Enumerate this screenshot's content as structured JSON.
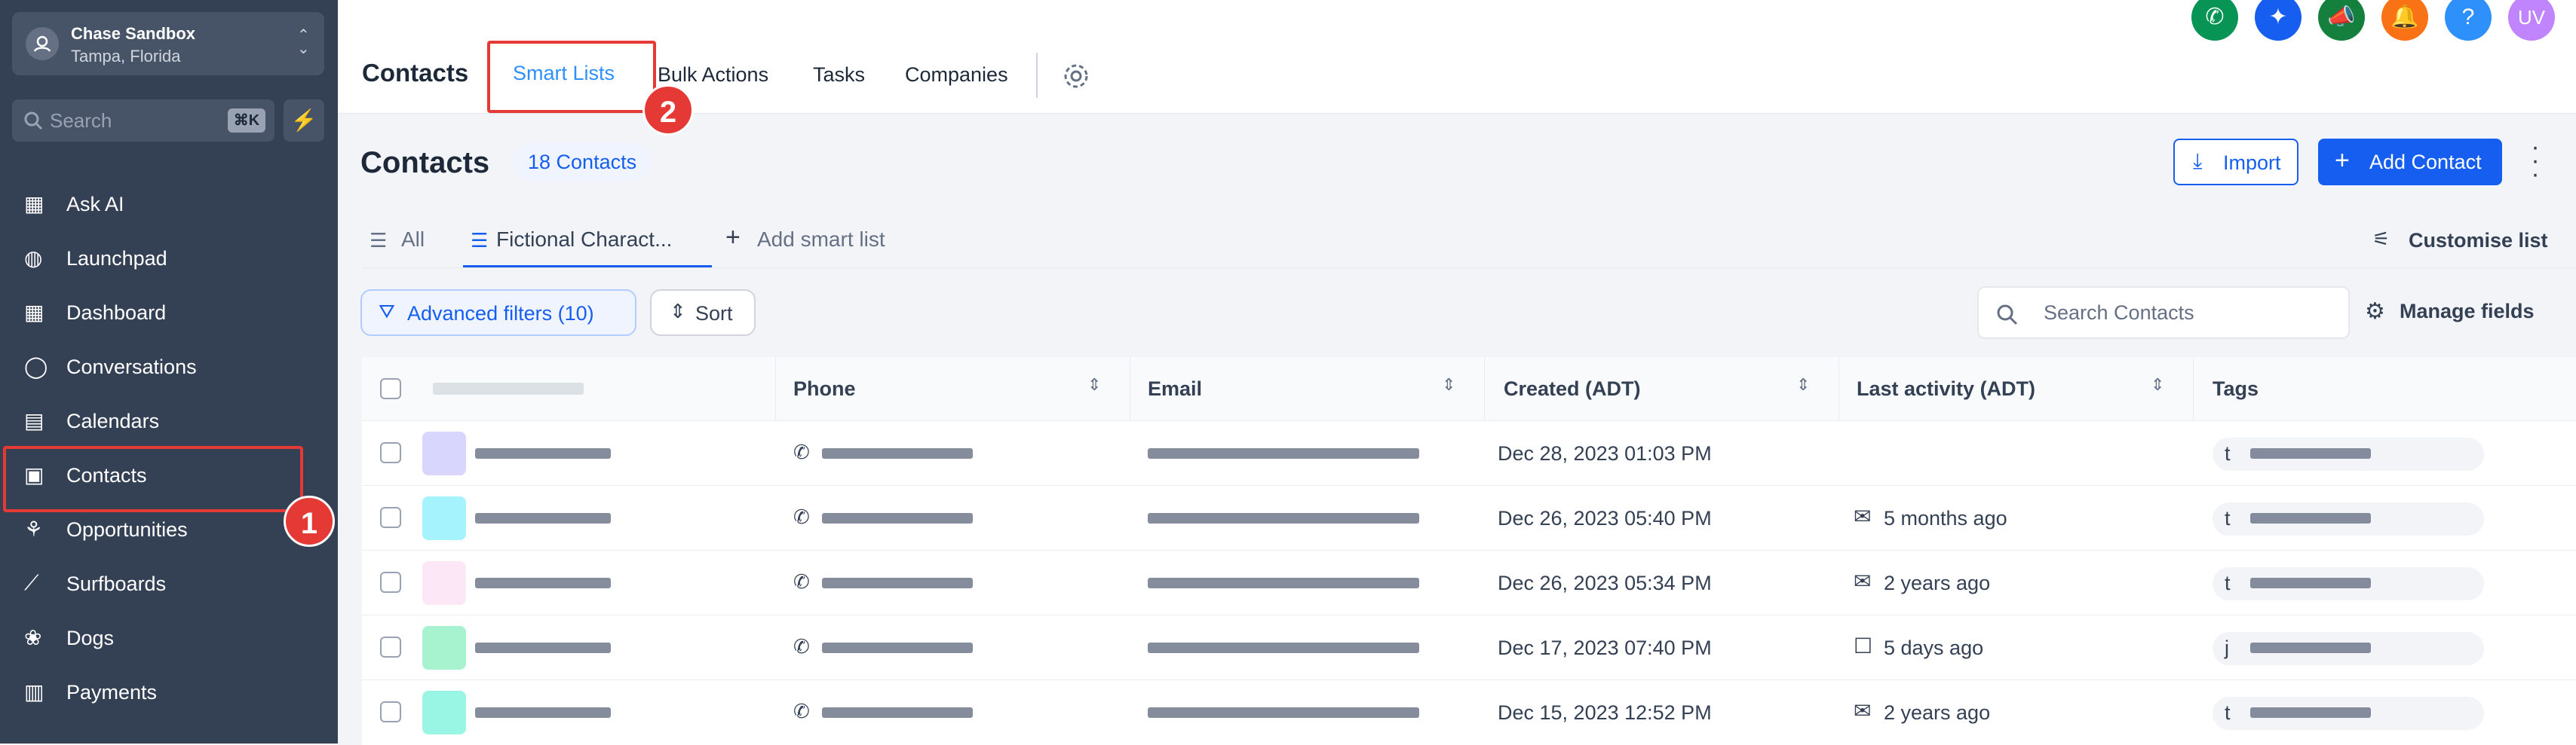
{
  "account": {
    "name": "Chase Sandbox",
    "location": "Tampa, Florida"
  },
  "sidebar": {
    "search_placeholder": "Search",
    "search_shortcut": "⌘K",
    "items": [
      {
        "label": "Ask AI",
        "icon": "grid-icon"
      },
      {
        "label": "Launchpad",
        "icon": "rocket-icon"
      },
      {
        "label": "Dashboard",
        "icon": "dashboard-icon"
      },
      {
        "label": "Conversations",
        "icon": "chat-icon"
      },
      {
        "label": "Calendars",
        "icon": "calendar-icon"
      },
      {
        "label": "Contacts",
        "icon": "contacts-icon"
      },
      {
        "label": "Opportunities",
        "icon": "opportunities-icon"
      },
      {
        "label": "Surfboards",
        "icon": "surfboard-icon"
      },
      {
        "label": "Dogs",
        "icon": "dog-icon"
      },
      {
        "label": "Payments",
        "icon": "payments-icon"
      }
    ]
  },
  "annotations": {
    "badge1": "1",
    "badge2": "2"
  },
  "topbar": {
    "title": "Contacts",
    "tabs": [
      "Smart Lists",
      "Bulk Actions",
      "Tasks",
      "Companies"
    ],
    "avatar": "UV",
    "help": "?"
  },
  "main": {
    "title": "Contacts",
    "count_badge": "18 Contacts",
    "import_label": "Import",
    "add_contact_label": "Add Contact",
    "list_tabs": [
      "All",
      "Fictional Charact...",
      "Add smart list"
    ],
    "customise_label": "Customise list",
    "advanced_filters_label": "Advanced filters (10)",
    "sort_label": "Sort",
    "search_placeholder": "Search Contacts",
    "manage_fields_label": "Manage fields"
  },
  "table": {
    "headers": [
      "Phone",
      "Email",
      "Created (ADT)",
      "Last activity (ADT)",
      "Tags"
    ],
    "rows": [
      {
        "created": "Dec 28, 2023 01:03 PM",
        "activity": "",
        "activity_icon": "",
        "tag_initial": "t"
      },
      {
        "created": "Dec 26, 2023 05:40 PM",
        "activity": "5 months ago",
        "activity_icon": "mail-icon",
        "tag_initial": "t"
      },
      {
        "created": "Dec 26, 2023 05:34 PM",
        "activity": "2 years ago",
        "activity_icon": "mail-icon",
        "tag_initial": "t"
      },
      {
        "created": "Dec 17, 2023 07:40 PM",
        "activity": "5 days ago",
        "activity_icon": "chat-icon",
        "tag_initial": "j"
      },
      {
        "created": "Dec 15, 2023 12:52 PM",
        "activity": "2 years ago",
        "activity_icon": "mail-icon",
        "tag_initial": "t"
      }
    ]
  },
  "colors": {
    "sidebar_bg": "#344054",
    "primary": "#155eef",
    "highlight": "#e53935"
  }
}
